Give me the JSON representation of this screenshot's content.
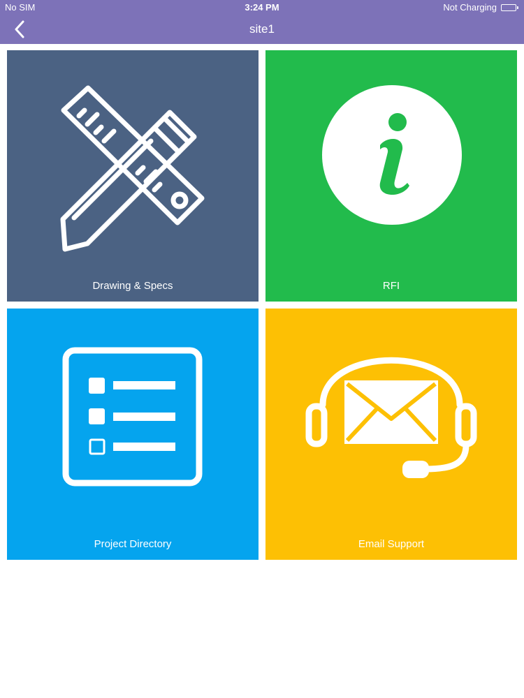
{
  "status_bar": {
    "carrier": "No SIM",
    "time": "3:24 PM",
    "charging": "Not Charging",
    "battery_level": 1.0
  },
  "nav": {
    "title": "site1",
    "back_icon": "chevron-left-icon"
  },
  "tiles": [
    {
      "label": "Drawing & Specs",
      "icon": "pencil-ruler-icon",
      "color": "#4b6283"
    },
    {
      "label": "RFI",
      "icon": "info-icon",
      "color": "#22bb4c"
    },
    {
      "label": "Project Directory",
      "icon": "checklist-icon",
      "color": "#05a4ee"
    },
    {
      "label": "Email Support",
      "icon": "headset-mail-icon",
      "color": "#fdc004"
    }
  ],
  "colors": {
    "header": "#7d72b8",
    "background": "#ffffff"
  }
}
